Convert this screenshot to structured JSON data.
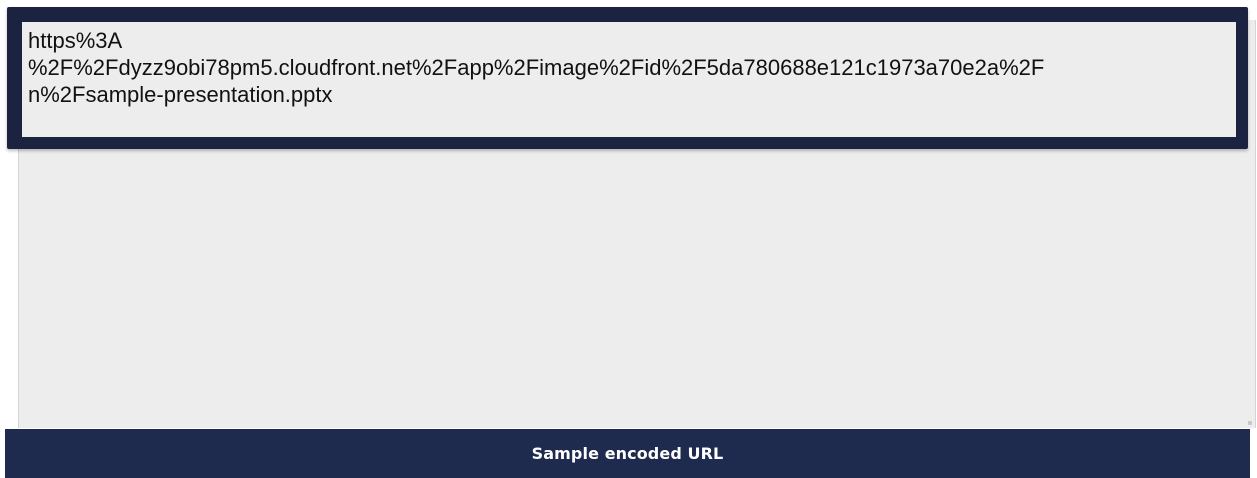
{
  "output": {
    "encoded_text": "https%3A\n%2F%2Fdyzz9obi78pm5.cloudfront.net%2Fapp%2Fimage%2Fid%2F5da780688e121c1973a70e2a%2F\nn%2Fsample-presentation.pptx"
  },
  "caption": {
    "label": "Sample encoded URL"
  },
  "colors": {
    "frame": "#1c2340",
    "caption_bar": "#1f2a4f",
    "textarea_bg": "#ededed"
  }
}
